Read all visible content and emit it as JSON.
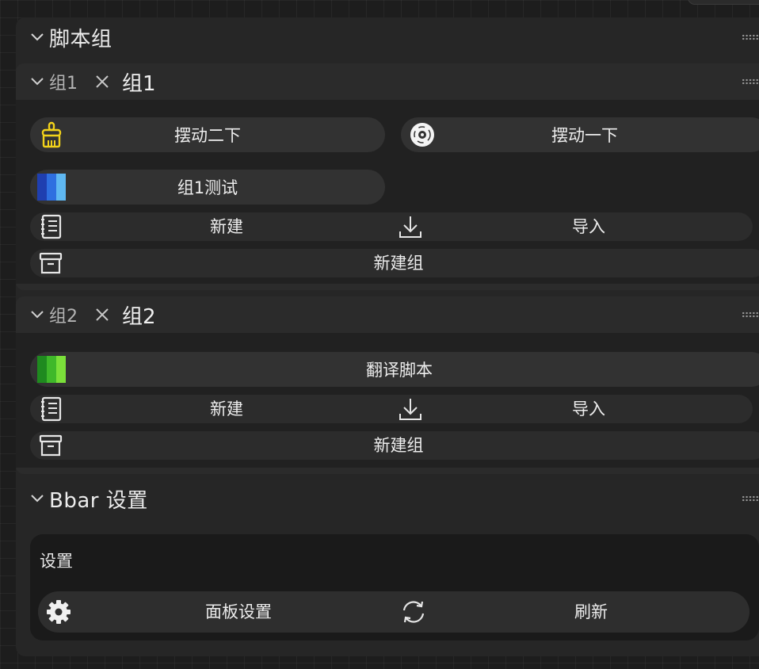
{
  "script_group": {
    "title": "脚本组",
    "groups": [
      {
        "name": "组1",
        "title": "组1",
        "buttons": [
          {
            "label": "摆动二下",
            "icon": "broom-icon"
          },
          {
            "label": "摆动一下",
            "icon": "disc-icon"
          },
          {
            "label": "组1测试",
            "icon": "blue-stripes-icon"
          }
        ],
        "actions": {
          "new": "新建",
          "import": "导入",
          "new_group": "新建组"
        }
      },
      {
        "name": "组2",
        "title": "组2",
        "buttons": [
          {
            "label": "翻译脚本",
            "icon": "green-stripes-icon"
          }
        ],
        "actions": {
          "new": "新建",
          "import": "导入",
          "new_group": "新建组"
        }
      }
    ]
  },
  "bbar_settings": {
    "title": "Bbar 设置",
    "card_label": "设置",
    "panel_settings": "面板设置",
    "refresh": "刷新"
  },
  "colors": {
    "accent_yellow": "#f2d21a",
    "blue_dark": "#1f3fb0",
    "blue_mid": "#2e6fe0",
    "blue_light": "#5fb8f2",
    "green_dark": "#1f8a1f",
    "green_mid": "#3fb82a",
    "green_light": "#7be03a"
  }
}
